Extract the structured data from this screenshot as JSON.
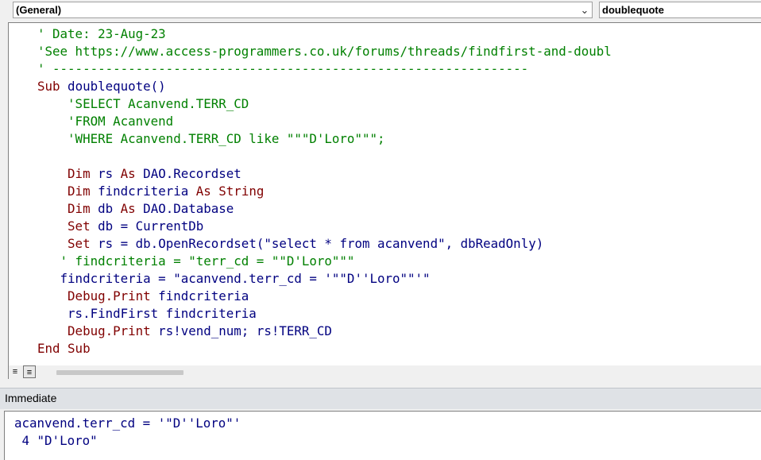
{
  "header": {
    "object_combo": "(General)",
    "procedure_combo": "doublequote"
  },
  "code": {
    "l1": "' Date: 23-Aug-23",
    "l2": "'See https://www.access-programmers.co.uk/forums/threads/findfirst-and-doubl",
    "l3": "' ---------------------------------------------------------------",
    "l4_kw": "Sub",
    "l4_rest": " doublequote()",
    "l5": "    'SELECT Acanvend.TERR_CD",
    "l6": "    'FROM Acanvend",
    "l7": "    'WHERE Acanvend.TERR_CD like \"\"\"D'Loro\"\"\";",
    "l8": "",
    "l9_kw1": "Dim",
    "l9_mid": " rs ",
    "l9_kw2": "As",
    "l9_rest": " DAO.Recordset",
    "l10_kw1": "Dim",
    "l10_mid": " findcriteria ",
    "l10_kw2": "As String",
    "l11_kw1": "Dim",
    "l11_mid": " db ",
    "l11_kw2": "As",
    "l11_rest": " DAO.Database",
    "l12_kw": "Set",
    "l12_rest": " db = CurrentDb",
    "l13_kw": "Set",
    "l13_rest": " rs = db.OpenRecordset(\"select * from acanvend\", dbReadOnly)",
    "l14": "   ' findcriteria = \"terr_cd = \"\"D'Loro\"\"\"",
    "l15": "   findcriteria = \"acanvend.terr_cd = '\"\"D''Loro\"\"'\"",
    "l16_kw": "Debug.Print",
    "l16_rest": " findcriteria",
    "l17": "    rs.FindFirst findcriteria",
    "l18_kw": "Debug.Print",
    "l18_rest": " rs!vend_num; rs!TERR_CD",
    "l19": "End Sub"
  },
  "immediate": {
    "title": "Immediate",
    "line1": "acanvend.terr_cd = '\"D''Loro\"'",
    "line2": " 4 \"D'Loro\""
  },
  "colors": {
    "comment": "#008000",
    "keyword": "#800000",
    "identifier": "#000080"
  }
}
